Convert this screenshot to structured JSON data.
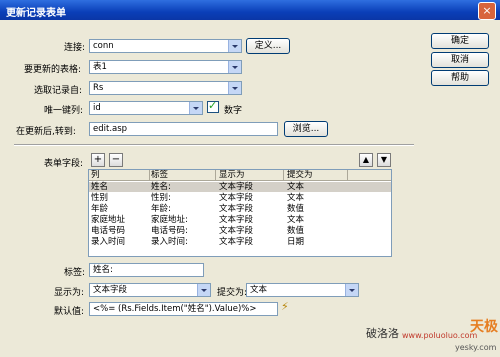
{
  "window": {
    "title": "更新记录表单",
    "close_glyph": "×"
  },
  "buttons": {
    "ok": "确定",
    "cancel": "取消",
    "help": "帮助",
    "define": "定义...",
    "browse": "浏览..."
  },
  "form": {
    "connection_label": "连接:",
    "connection_value": "conn",
    "table_label": "要更新的表格:",
    "table_value": "表1",
    "recordset_label": "选取记录自:",
    "recordset_value": "Rs",
    "key_label": "唯一键列:",
    "key_value": "id",
    "numeric_label": "数字",
    "numeric_checked": true,
    "redirect_label": "在更新后,转到:",
    "redirect_value": "edit.asp"
  },
  "fields": {
    "label": "表单字段:",
    "add": "+",
    "remove": "−",
    "up": "▲",
    "down": "▼",
    "columns": [
      "列",
      "标签",
      "显示为",
      "提交为"
    ],
    "rows": [
      [
        "姓名",
        "姓名:",
        "文本字段",
        "文本"
      ],
      [
        "性别",
        "性别:",
        "文本字段",
        "文本"
      ],
      [
        "年龄",
        "年龄:",
        "文本字段",
        "数值"
      ],
      [
        "家庭地址",
        "家庭地址:",
        "文本字段",
        "文本"
      ],
      [
        "电话号码",
        "电话号码:",
        "文本字段",
        "数值"
      ],
      [
        "录入时间",
        "录入时间:",
        "文本字段",
        "日期"
      ]
    ],
    "selected_index": 0
  },
  "detail": {
    "label_label": "标签:",
    "label_value": "姓名:",
    "display_label": "显示为:",
    "display_value": "文本字段",
    "submit_label": "提交为:",
    "submit_value": "文本",
    "default_label": "默认值:",
    "default_value": "<%= (Rs.Fields.Item(\"姓名\").Value)%>"
  },
  "watermark": {
    "author": "破洛洛",
    "url": "www.poluoluo.com",
    "brand": "天极",
    "brand_url": "yesky.com"
  }
}
